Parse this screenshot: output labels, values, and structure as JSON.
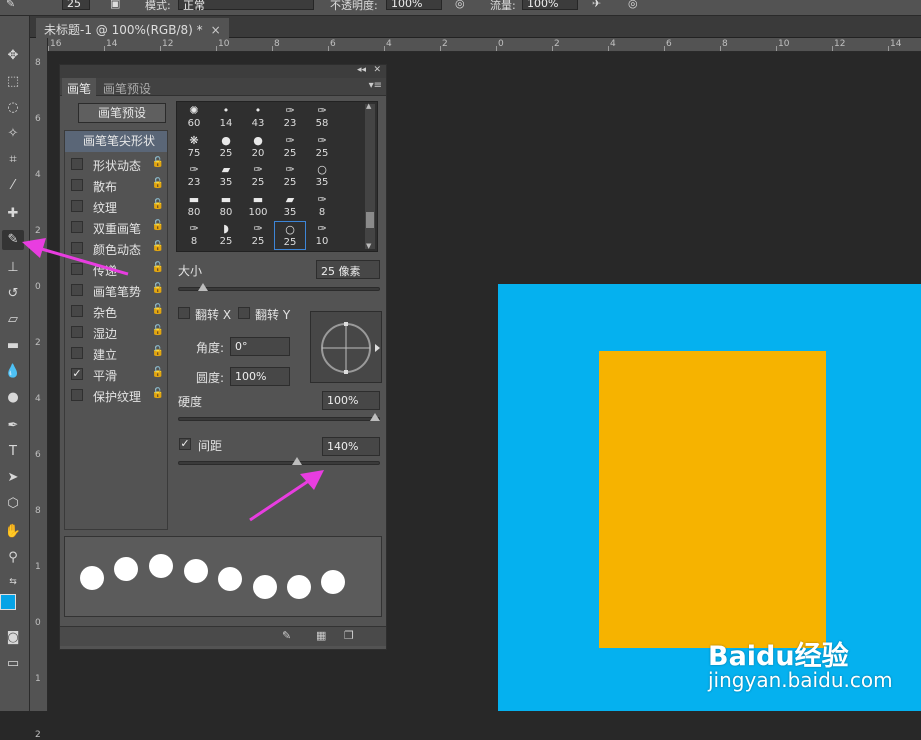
{
  "options_bar": {
    "size_value": "25",
    "mode_label": "模式:",
    "mode_value": "正常",
    "opacity_label": "不透明度:",
    "opacity_value": "100%",
    "flow_label": "流量:",
    "flow_value": "100%"
  },
  "document": {
    "tab_title": "未标题-1 @ 100%(RGB/8) *",
    "close_glyph": "×"
  },
  "ruler_h": [
    "16",
    "14",
    "12",
    "10",
    "8",
    "6",
    "4",
    "2",
    "0",
    "2",
    "4",
    "6",
    "8",
    "10",
    "12",
    "14"
  ],
  "ruler_v": [
    "8",
    "6",
    "4",
    "2",
    "0",
    "2",
    "4",
    "6",
    "8",
    "1",
    "0",
    "1",
    "2"
  ],
  "panel": {
    "collapse_glyph": "◂◂",
    "close_glyph": "✕",
    "tabs": [
      "画笔",
      "画笔预设"
    ],
    "menu_glyph": "▾≡",
    "preset_button": "画笔预设",
    "tip_shape": "画笔笔尖形状",
    "options": [
      {
        "label": "形状动态",
        "checked": false
      },
      {
        "label": "散布",
        "checked": false
      },
      {
        "label": "纹理",
        "checked": false
      },
      {
        "label": "双重画笔",
        "checked": false
      },
      {
        "label": "颜色动态",
        "checked": false
      },
      {
        "label": "传递",
        "checked": false
      },
      {
        "label": "画笔笔势",
        "checked": false
      },
      {
        "label": "杂色",
        "checked": false
      },
      {
        "label": "湿边",
        "checked": false
      },
      {
        "label": "建立",
        "checked": false
      },
      {
        "label": "平滑",
        "checked": true
      },
      {
        "label": "保护纹理",
        "checked": false
      }
    ],
    "brush_sizes": [
      "60",
      "14",
      "43",
      "23",
      "58",
      "75",
      "25",
      "20",
      "25",
      "25",
      "23",
      "35",
      "25",
      "25",
      "35",
      "80",
      "80",
      "100",
      "35",
      "8",
      "8",
      "25",
      "25",
      "25",
      "10"
    ],
    "selected_brush_index": 23,
    "size_label": "大小",
    "size_value": "25 像素",
    "size_fraction": 0.12,
    "flip_x_label": "翻转 X",
    "flip_y_label": "翻转 Y",
    "angle_label": "角度:",
    "angle_value": "0°",
    "roundness_label": "圆度:",
    "roundness_value": "100%",
    "hardness_label": "硬度",
    "hardness_value": "100%",
    "hardness_fraction": 1.0,
    "spacing_label": "间距",
    "spacing_checked": true,
    "spacing_value": "140%",
    "spacing_fraction": 0.6,
    "checkmark": "✓"
  },
  "colors": {
    "canvas_blue": "#05b1ef",
    "canvas_orange": "#f6b300",
    "arrow": "#e83de0",
    "foreground": "#05a3e6",
    "background": "#ffffff"
  },
  "watermark": {
    "brand": "Baidu经验",
    "url": "jingyan.baidu.com"
  }
}
